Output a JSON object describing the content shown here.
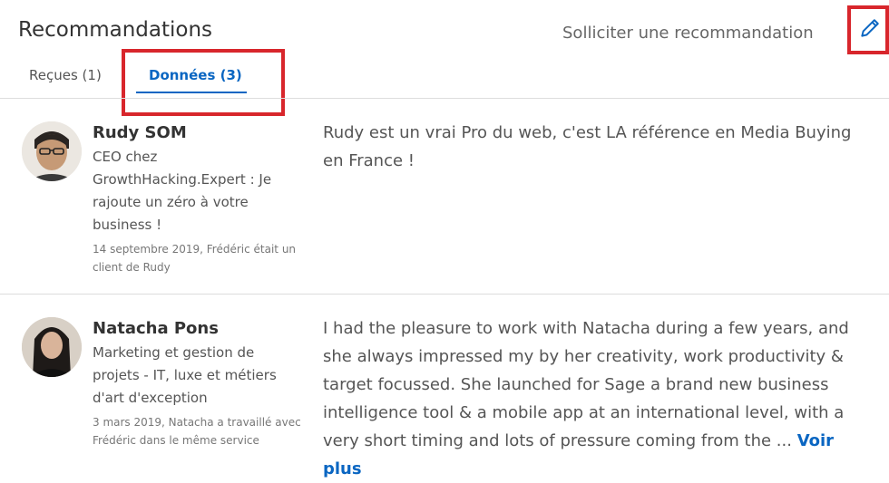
{
  "header": {
    "title": "Recommandations",
    "request_link": "Solliciter une recommandation"
  },
  "tabs": [
    {
      "label": "Reçues (1)"
    },
    {
      "label": "Données (3)"
    }
  ],
  "recommendations": [
    {
      "name": "Rudy SOM",
      "headline": "CEO chez GrowthHacking.Expert : Je rajoute un zéro à votre business !",
      "meta": "14 septembre 2019, Frédéric était un client de Rudy",
      "text": "Rudy est un vrai Pro du web, c'est LA référence en Media Buying en France !"
    },
    {
      "name": "Natacha Pons",
      "headline": "Marketing et gestion de projets - IT, luxe et métiers d'art d'exception",
      "meta": "3 mars 2019, Natacha a travaillé avec Frédéric dans le même service",
      "text": "I had the pleasure to work with Natacha during a few years, and she always impressed my by her creativity, work productivity & target focussed. She launched for Sage a brand new business intelligence tool & a mobile app at an international level, with a very short timing and lots of pressure coming from the ...",
      "more": "Voir plus"
    }
  ],
  "colors": {
    "accent": "#0a66c2",
    "highlight": "#d8262c"
  },
  "icons": {
    "edit": "pencil-icon"
  }
}
